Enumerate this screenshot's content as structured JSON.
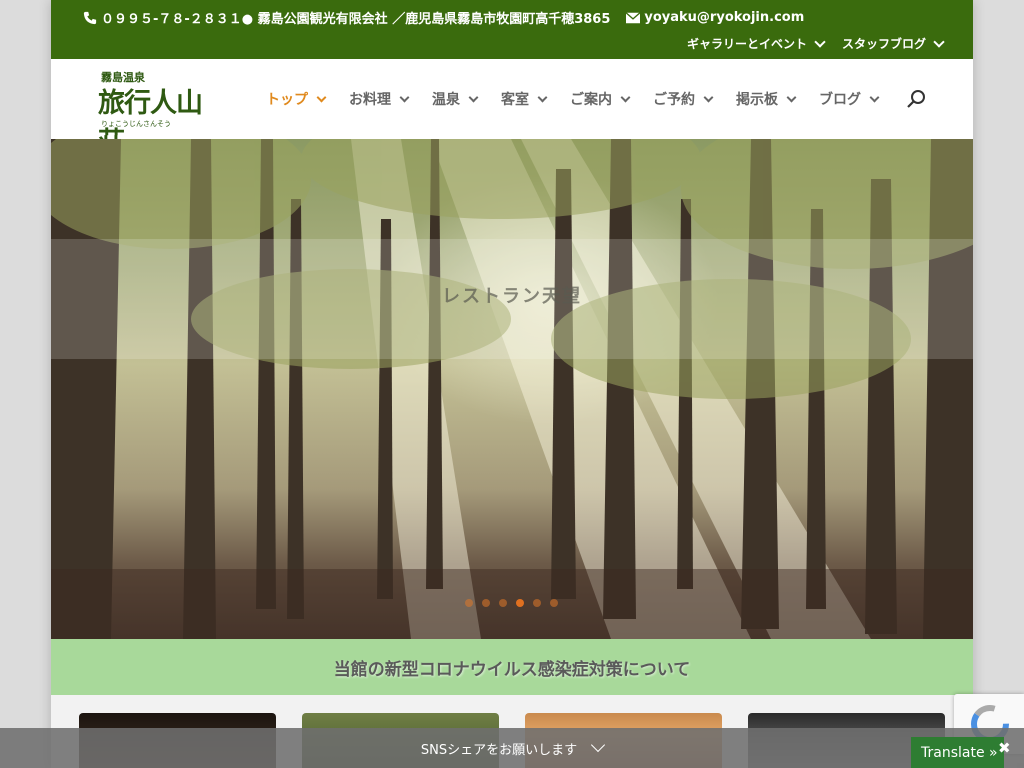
{
  "topbar": {
    "phone": "０９９５-７８-２８３１",
    "company": "● 霧島公園観光有限会社 ／鹿児島県霧島市牧園町高千穂3865",
    "email": "yoyaku@ryokojin.com",
    "secondary_nav": [
      "ギャラリーとイベント",
      "スタッフブログ"
    ]
  },
  "logo": {
    "small_text": "霧島温泉",
    "main_text": "旅行人山荘",
    "kana": "りょこうじんさんそう"
  },
  "main_nav": [
    {
      "label": "トップ",
      "active": true
    },
    {
      "label": "お料理",
      "active": false
    },
    {
      "label": "温泉",
      "active": false
    },
    {
      "label": "客室",
      "active": false
    },
    {
      "label": "ご案内",
      "active": false
    },
    {
      "label": "ご予約",
      "active": false
    },
    {
      "label": "掲示板",
      "active": false
    },
    {
      "label": "ブログ",
      "active": false
    }
  ],
  "hero": {
    "caption": "レストラン天望",
    "slide_count": 6,
    "active_slide": 4
  },
  "notice": {
    "text": "当館の新型コロナウイルス感染症対策について"
  },
  "share_bar": {
    "text": "SNSシェアをお願いします"
  },
  "translate": {
    "label": "Translate »",
    "close": "✖"
  },
  "colors": {
    "topbar": "#3a6b0d",
    "accent": "#e08a1e",
    "notice_bg": "#a8d99a"
  }
}
